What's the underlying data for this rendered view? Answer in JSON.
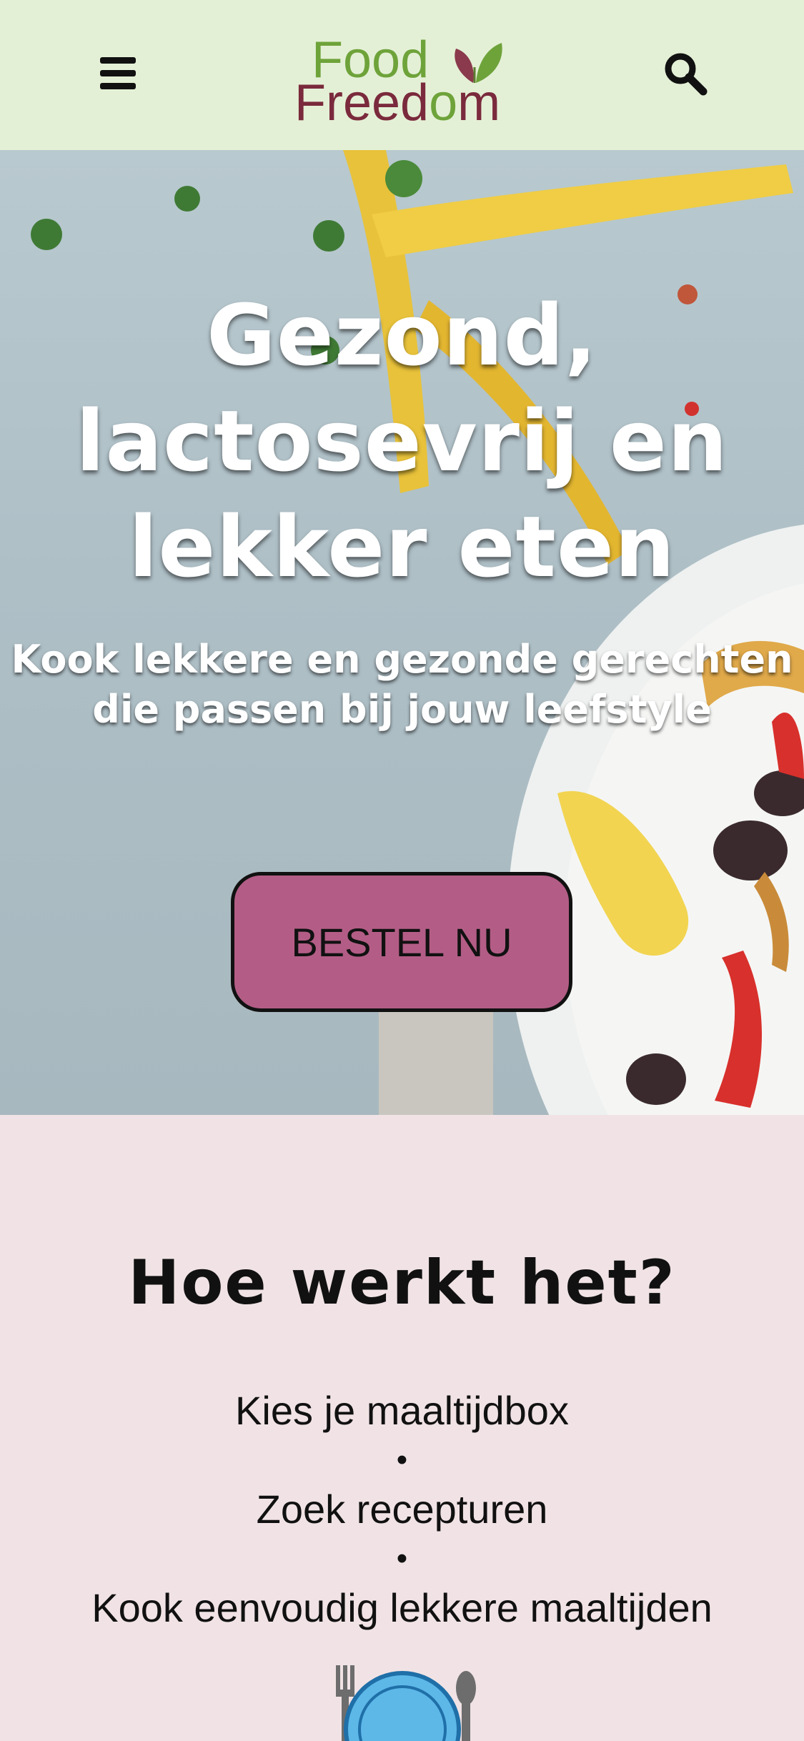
{
  "header": {
    "logo_line1": "Food",
    "logo_line2_a": "Freed",
    "logo_line2_b": "o",
    "logo_line2_c": "m",
    "menu_icon": "hamburger-menu-icon",
    "search_icon": "search-icon"
  },
  "hero": {
    "title_line1": "Gezond,",
    "title_line2": "lactosevrij en",
    "title_line3": "lekker eten",
    "subtitle_line1": "Kook lekkere en gezonde gerechten",
    "subtitle_line2": "die passen bij jouw leefstyle",
    "cta_label": "BESTEL NU"
  },
  "how": {
    "title": "Hoe werkt het?",
    "steps": [
      "Kies je maaltijdbox",
      "Zoek recepturen",
      "Kook eenvoudig lekkere maaltijden"
    ],
    "separator": "•",
    "illustration_icon": "plate-cutlery-icon"
  },
  "colors": {
    "header_bg": "#e4f0d6",
    "section_bg": "#f1e3e5",
    "cta_bg": "#b35d86",
    "logo_green": "#6ea33a",
    "logo_burgundy": "#7a2a3c"
  }
}
